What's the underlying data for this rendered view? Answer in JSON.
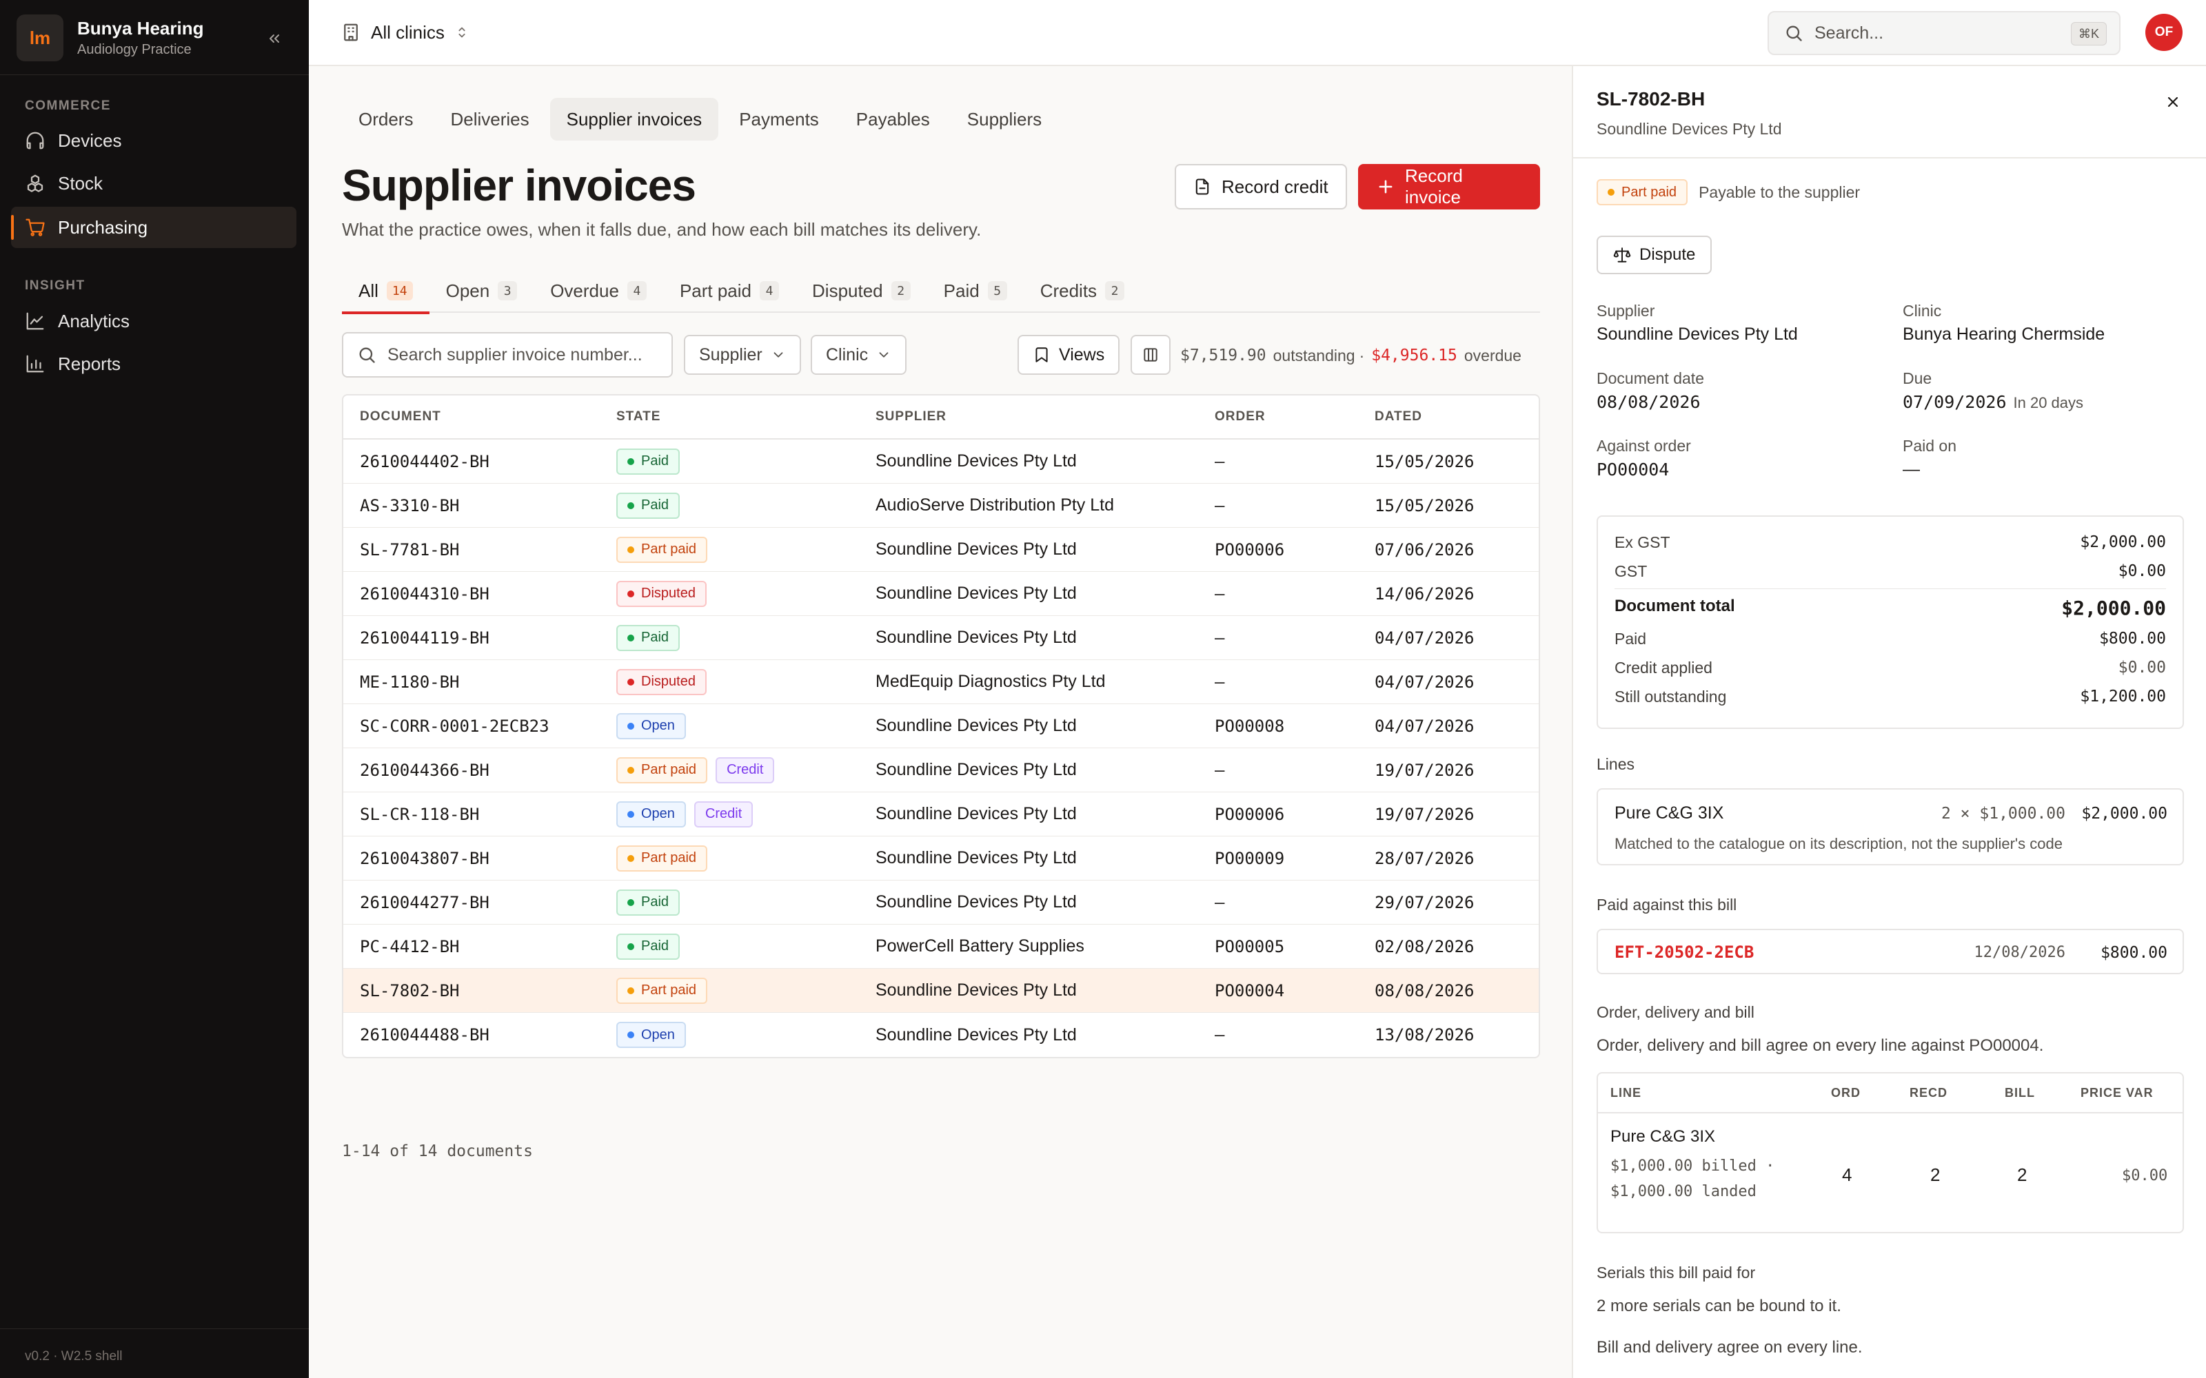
{
  "brand": {
    "logo_text": "lm",
    "name": "Bunya Hearing",
    "subtitle": "Audiology Practice"
  },
  "sidebar": {
    "sections": [
      {
        "title": "COMMERCE",
        "items": [
          {
            "label": "Devices",
            "icon": "headphones-icon"
          },
          {
            "label": "Stock",
            "icon": "boxes-icon"
          },
          {
            "label": "Purchasing",
            "icon": "cart-icon",
            "active": true
          }
        ]
      },
      {
        "title": "INSIGHT",
        "items": [
          {
            "label": "Analytics",
            "icon": "line-chart-icon"
          },
          {
            "label": "Reports",
            "icon": "bar-chart-icon"
          }
        ]
      }
    ],
    "footer": "v0.2 · W2.5 shell"
  },
  "topbar": {
    "clinic_selector": "All clinics",
    "search_placeholder": "Search...",
    "search_shortcut": "⌘K",
    "avatar_initials": "OF"
  },
  "section_tabs": [
    "Orders",
    "Deliveries",
    "Supplier invoices",
    "Payments",
    "Payables",
    "Suppliers"
  ],
  "active_section_tab": "Supplier invoices",
  "page": {
    "title": "Supplier invoices",
    "subtitle": "What the practice owes, when it falls due, and how each bill matches its delivery.",
    "record_credit_label": "Record credit",
    "record_invoice_label": "Record invoice"
  },
  "filter_tabs": [
    {
      "label": "All",
      "count": "14",
      "active": true
    },
    {
      "label": "Open",
      "count": "3"
    },
    {
      "label": "Overdue",
      "count": "4"
    },
    {
      "label": "Part paid",
      "count": "4"
    },
    {
      "label": "Disputed",
      "count": "2"
    },
    {
      "label": "Paid",
      "count": "5"
    },
    {
      "label": "Credits",
      "count": "2"
    }
  ],
  "toolbar": {
    "search_placeholder": "Search supplier invoice number...",
    "supplier_filter": "Supplier",
    "clinic_filter": "Clinic",
    "views_label": "Views",
    "outstanding_amount": "$7,519.90",
    "outstanding_label": "outstanding",
    "separator": "·",
    "overdue_amount": "$4,956.15",
    "overdue_label": "overdue"
  },
  "table": {
    "columns": [
      "DOCUMENT",
      "STATE",
      "SUPPLIER",
      "ORDER",
      "DATED"
    ],
    "rows": [
      {
        "document": "2610044402-BH",
        "state": "Paid",
        "state_kind": "paid",
        "extra_badge": "",
        "supplier": "Soundline Devices Pty Ltd",
        "order": "—",
        "dated": "15/05/2026"
      },
      {
        "document": "AS-3310-BH",
        "state": "Paid",
        "state_kind": "paid",
        "extra_badge": "",
        "supplier": "AudioServe Distribution Pty Ltd",
        "order": "—",
        "dated": "15/05/2026"
      },
      {
        "document": "SL-7781-BH",
        "state": "Part paid",
        "state_kind": "partpaid",
        "extra_badge": "",
        "supplier": "Soundline Devices Pty Ltd",
        "order": "PO00006",
        "dated": "07/06/2026"
      },
      {
        "document": "2610044310-BH",
        "state": "Disputed",
        "state_kind": "disputed",
        "extra_badge": "",
        "supplier": "Soundline Devices Pty Ltd",
        "order": "—",
        "dated": "14/06/2026"
      },
      {
        "document": "2610044119-BH",
        "state": "Paid",
        "state_kind": "paid",
        "extra_badge": "",
        "supplier": "Soundline Devices Pty Ltd",
        "order": "—",
        "dated": "04/07/2026"
      },
      {
        "document": "ME-1180-BH",
        "state": "Disputed",
        "state_kind": "disputed",
        "extra_badge": "",
        "supplier": "MedEquip Diagnostics Pty Ltd",
        "order": "—",
        "dated": "04/07/2026"
      },
      {
        "document": "SC-CORR-0001-2ECB23",
        "state": "Open",
        "state_kind": "open",
        "extra_badge": "",
        "supplier": "Soundline Devices Pty Ltd",
        "order": "PO00008",
        "dated": "04/07/2026"
      },
      {
        "document": "2610044366-BH",
        "state": "Part paid",
        "state_kind": "partpaid",
        "extra_badge": "Credit",
        "supplier": "Soundline Devices Pty Ltd",
        "order": "—",
        "dated": "19/07/2026"
      },
      {
        "document": "SL-CR-118-BH",
        "state": "Open",
        "state_kind": "open",
        "extra_badge": "Credit",
        "supplier": "Soundline Devices Pty Ltd",
        "order": "PO00006",
        "dated": "19/07/2026"
      },
      {
        "document": "2610043807-BH",
        "state": "Part paid",
        "state_kind": "partpaid",
        "extra_badge": "",
        "supplier": "Soundline Devices Pty Ltd",
        "order": "PO00009",
        "dated": "28/07/2026"
      },
      {
        "document": "2610044277-BH",
        "state": "Paid",
        "state_kind": "paid",
        "extra_badge": "",
        "supplier": "Soundline Devices Pty Ltd",
        "order": "—",
        "dated": "29/07/2026"
      },
      {
        "document": "PC-4412-BH",
        "state": "Paid",
        "state_kind": "paid",
        "extra_badge": "",
        "supplier": "PowerCell Battery Supplies",
        "order": "PO00005",
        "dated": "02/08/2026"
      },
      {
        "document": "SL-7802-BH",
        "state": "Part paid",
        "state_kind": "partpaid",
        "extra_badge": "",
        "supplier": "Soundline Devices Pty Ltd",
        "order": "PO00004",
        "dated": "08/08/2026",
        "selected": true
      },
      {
        "document": "2610044488-BH",
        "state": "Open",
        "state_kind": "open",
        "extra_badge": "",
        "supplier": "Soundline Devices Pty Ltd",
        "order": "—",
        "dated": "13/08/2026"
      }
    ],
    "pagination": "1-14 of 14 documents"
  },
  "detail": {
    "title": "SL-7802-BH",
    "subtitle": "Soundline Devices Pty Ltd",
    "status": "Part paid",
    "status_text": "Payable to the supplier",
    "dispute_label": "Dispute",
    "fields": {
      "supplier_label": "Supplier",
      "supplier_value": "Soundline Devices Pty Ltd",
      "clinic_label": "Clinic",
      "clinic_value": "Bunya Hearing Chermside",
      "doc_date_label": "Document date",
      "doc_date_value": "08/08/2026",
      "due_label": "Due",
      "due_value": "07/09/2026",
      "due_hint": "In 20 days",
      "order_label": "Against order",
      "order_value": "PO00004",
      "paid_on_label": "Paid on",
      "paid_on_value": "—"
    },
    "totals": [
      {
        "label": "Ex GST",
        "value": "$2,000.00"
      },
      {
        "label": "GST",
        "value": "$0.00"
      },
      {
        "label": "Document total",
        "value": "$2,000.00"
      },
      {
        "label": "Paid",
        "value": "$800.00"
      },
      {
        "label": "Credit applied",
        "value": "$0.00"
      },
      {
        "label": "Still outstanding",
        "value": "$1,200.00"
      }
    ],
    "lines_label": "Lines",
    "line": {
      "name": "Pure C&G 3IX",
      "qty": "2 × $1,000.00",
      "amount": "$2,000.00",
      "note": "Matched to the catalogue on its description, not the supplier's code"
    },
    "paid_label": "Paid against this bill",
    "payment": {
      "ref": "EFT-20502-2ECB",
      "date": "12/08/2026",
      "amount": "$800.00"
    },
    "match_label": "Order, delivery and bill",
    "match_text": "Order, delivery and bill agree on every line against PO00004.",
    "match_table": {
      "columns": [
        "LINE",
        "ORD",
        "RECD",
        "BILL",
        "PRICE VAR"
      ],
      "row": {
        "name": "Pure C&G 3IX",
        "detail": "$1,000.00 billed · $1,000.00 landed",
        "ord": "4",
        "recd": "2",
        "bill": "2",
        "price_var": "$0.00"
      }
    },
    "serials_label": "Serials this bill paid for",
    "serials_text": "2 more serials can be bound to it.",
    "agree_text": "Bill and delivery agree on every line."
  },
  "colors": {
    "accent": "#dc2626",
    "sidebar_bg": "#121010",
    "active_orange": "#f97316",
    "selected_row": "#fef1e7"
  }
}
